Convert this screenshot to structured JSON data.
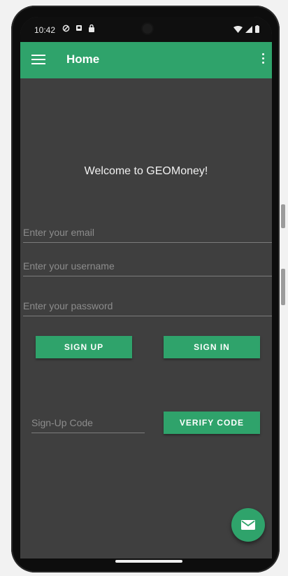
{
  "status_bar": {
    "time": "10:42",
    "left_icons": [
      "do-not-disturb-icon",
      "notification-icon",
      "lock-icon"
    ],
    "right_icons": [
      "wifi-icon",
      "signal-icon",
      "battery-icon"
    ]
  },
  "app_bar": {
    "title": "Home",
    "menu_icon": "hamburger-menu-icon",
    "overflow_icon": "kebab-menu-icon",
    "color": "#2fa36b"
  },
  "main": {
    "welcome_text": "Welcome to GEOMoney!",
    "email_placeholder": "Enter your email",
    "username_placeholder": "Enter your username",
    "password_placeholder": "Enter your password",
    "sign_up_label": "SIGN UP",
    "sign_in_label": "SIGN IN",
    "code_placeholder": "Sign-Up Code",
    "verify_label": "VERIFY CODE"
  },
  "fab": {
    "icon": "mail-icon"
  },
  "colors": {
    "accent": "#2fa36b",
    "background": "#3f3f3f"
  }
}
